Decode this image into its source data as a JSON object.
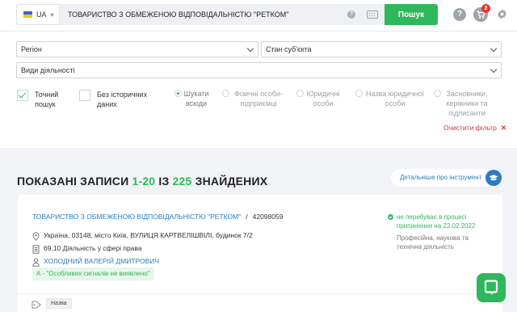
{
  "header": {
    "language": "UA",
    "query": "ТОВАРИСТВО З ОБМЕЖЕНОЮ ВІДПОВІДАЛЬНІСТЮ \"РЕТКОМ\"",
    "search_label": "Пошук",
    "help_icon": "?",
    "cart_badge": "2"
  },
  "filters": {
    "region": "Регіон",
    "state": "Стан суб'єкта",
    "activity": "Види діяльності",
    "exact_search": "Точний пошук",
    "no_history": "Без історичних даних",
    "radio_options": [
      "Шукати всюди",
      "Фізичні особи-підприємці",
      "Юридичні особи",
      "Назва юридичної особи",
      "Засновники, керівники та підписанти"
    ],
    "clear_filter": "Очистити фільтр"
  },
  "results": {
    "title_prefix": "ПОКАЗАНІ ЗАПИСИ",
    "range": "1-20",
    "from": "ІЗ",
    "total": "225",
    "title_suffix": "ЗНАЙДЕНИХ",
    "details_button": "Детальніше про інструмент"
  },
  "card": {
    "company_name": "ТОВАРИСТВО З ОБМЕЖЕНОЮ ВІДПОВІДАЛЬНІСТЮ \"РЕТКОМ\"",
    "separator": "/",
    "code": "42098059",
    "address": "Україна, 03148, місто Київ, ВУЛИЦЯ КАРТВЕЛІШВІЛІ, будинок 7/2",
    "activity": "69.10 Діяльність у сфері права",
    "person": "ХОЛОДНИЙ ВАЛЕРІЙ ДМИТРОВИЧ",
    "signal": "А - \"Особливих сигналів не виявлено\"",
    "status": "не перебуває в процесі припинення на 22.02.2022",
    "kved_section": "Професійна, наукова та технічна діяльність",
    "tag": "Назва"
  },
  "colors": {
    "accent_green": "#2eb85c",
    "link_blue": "#2a7dbf",
    "danger_red": "#e3342f"
  }
}
